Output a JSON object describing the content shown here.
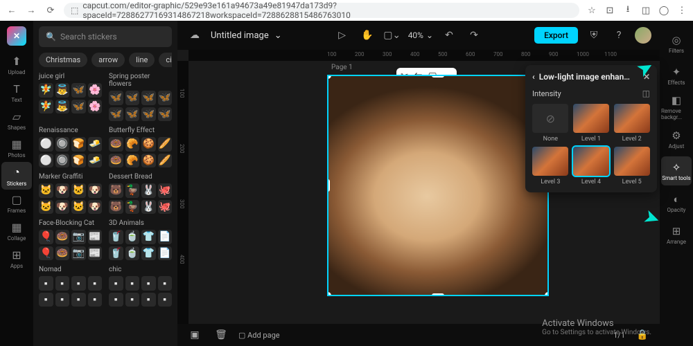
{
  "browser": {
    "url": "capcut.com/editor-graphic/529e93e161a94673a49e81947da173d9?spaceId=72886277169314867218workspaceId=7288628815486763010"
  },
  "left_nav": [
    {
      "icon": "⬆",
      "label": "Upload"
    },
    {
      "icon": "T",
      "label": "Text"
    },
    {
      "icon": "▱",
      "label": "Shapes"
    },
    {
      "icon": "▦",
      "label": "Photos"
    },
    {
      "icon": "◔",
      "label": "Stickers"
    },
    {
      "icon": "▢",
      "label": "Frames"
    },
    {
      "icon": "▦",
      "label": "Collage"
    },
    {
      "icon": "⊞",
      "label": "Apps"
    }
  ],
  "search": {
    "placeholder": "Search stickers"
  },
  "chips": [
    "Christmas",
    "arrow",
    "line",
    "circ"
  ],
  "sticker_cats": [
    {
      "left": "juice girl",
      "right": "Spring poster flowers"
    },
    {
      "left": "Renaissance",
      "right": "Butterfly Effect"
    },
    {
      "left": "Marker Graffiti",
      "right": "Dessert Bread"
    },
    {
      "left": "Face-Blocking Cat",
      "right": "3D Animals"
    },
    {
      "left": "Nomad",
      "right": "chic"
    }
  ],
  "header": {
    "title": "Untitled image",
    "zoom": "40%",
    "export": "Export"
  },
  "ruler_h": [
    "100",
    "200",
    "300",
    "400",
    "500",
    "600",
    "700",
    "800",
    "900",
    "1000",
    "1100"
  ],
  "ruler_v": [
    "100",
    "200",
    "300",
    "400"
  ],
  "page_label": "Page 1",
  "popup": {
    "title": "Low-light image enhan…",
    "intensity": "Intensity",
    "levels": [
      "None",
      "Level 1",
      "Level 2",
      "Level 3",
      "Level 4",
      "Level 5"
    ],
    "selected": 4
  },
  "right_nav": [
    {
      "icon": "◎",
      "label": "Filters"
    },
    {
      "icon": "✦",
      "label": "Effects"
    },
    {
      "icon": "◧",
      "label": "Remove backgr..."
    },
    {
      "icon": "⚙",
      "label": "Adjust"
    },
    {
      "icon": "✧",
      "label": "Smart tools"
    },
    {
      "icon": "◐",
      "label": "Opacity"
    },
    {
      "icon": "⊞",
      "label": "Arrange"
    }
  ],
  "bottom": {
    "addpage": "Add page",
    "pages": "1/1"
  },
  "watermark": {
    "title": "Activate Windows",
    "sub": "Go to Settings to activate Windows."
  }
}
